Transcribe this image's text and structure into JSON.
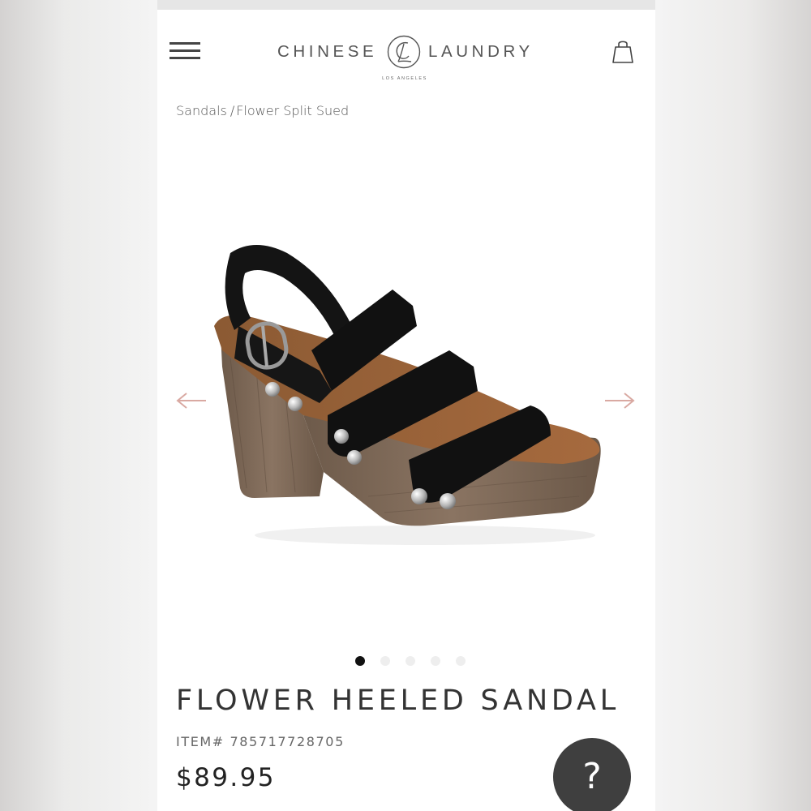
{
  "header": {
    "menu_icon": "hamburger-menu-icon",
    "brand": {
      "left_word": "CHINESE",
      "right_word": "LAUNDRY",
      "subtitle": "LOS ANGELES",
      "logo_icon": "cl-monogram-icon"
    },
    "cart_icon": "shopping-bag-icon"
  },
  "breadcrumb": {
    "category": "Sandals",
    "separator": "/",
    "current": "Flower Split Sued"
  },
  "gallery": {
    "image_icon": "black-suede-platform-sandal",
    "prev_icon": "arrow-left-icon",
    "next_icon": "arrow-right-icon",
    "dots_total": 5,
    "active_index": 0
  },
  "product": {
    "title": "FLOWER HEELED SANDAL",
    "item_label": "ITEM#",
    "item_number": "785717728705",
    "price": "$89.95"
  },
  "help": {
    "label": "?"
  },
  "colors": {
    "accent_arrow": "#d9a9a2",
    "dot_active": "#111111",
    "dot_inactive": "#eeeeee",
    "help_bg": "#3f3f3f"
  }
}
